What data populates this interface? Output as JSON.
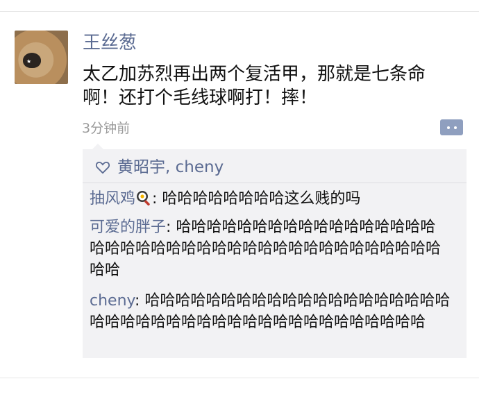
{
  "post": {
    "author": "王丝葱",
    "text": "太乙加苏烈再出两个复活甲，那就是七条命啊！还打个毛线球啊打！摔！",
    "time": "3分钟前"
  },
  "likes": {
    "names": "黄昭宇, cheny"
  },
  "comments": [
    {
      "author": "抽风鸡",
      "author_icon": "frying-pan-egg-icon",
      "text": "哈哈哈哈哈哈哈哈这么贱的吗"
    },
    {
      "author": "可爱的胖子",
      "text": "哈哈哈哈哈哈哈哈哈哈哈哈哈哈哈哈哈哈哈哈哈哈哈哈哈哈哈哈哈哈哈哈哈哈哈哈哈哈哈哈哈哈"
    },
    {
      "author": "cheny",
      "text": "哈哈哈哈哈哈哈哈哈哈哈哈哈哈哈哈哈哈哈哈哈哈哈哈哈哈哈哈哈哈哈哈哈哈哈哈哈哈哈哈哈哈"
    }
  ],
  "colors": {
    "name_link": "#5b6b92",
    "panel_bg": "#f2f2f4",
    "action_button": "#8f9fbf"
  }
}
